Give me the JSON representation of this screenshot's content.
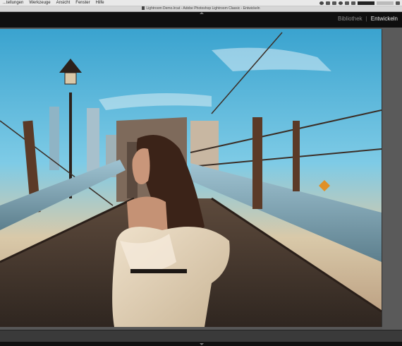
{
  "menubar": {
    "items": [
      "...tellungen",
      "Werkzeuge",
      "Ansicht",
      "Fenster",
      "Hilfe"
    ]
  },
  "window": {
    "title": "Lightroom Demo.lrcat - Adobe Photoshop Lightroom Classic - Entwickeln"
  },
  "modules": {
    "library": "Bibliothek",
    "separator": "|",
    "develop": "Entwickeln"
  },
  "colors": {
    "panel": "#0f0f0f",
    "active_module": "#e8e8e8",
    "inactive_module": "#8a8a8a",
    "workarea": "#575757"
  }
}
